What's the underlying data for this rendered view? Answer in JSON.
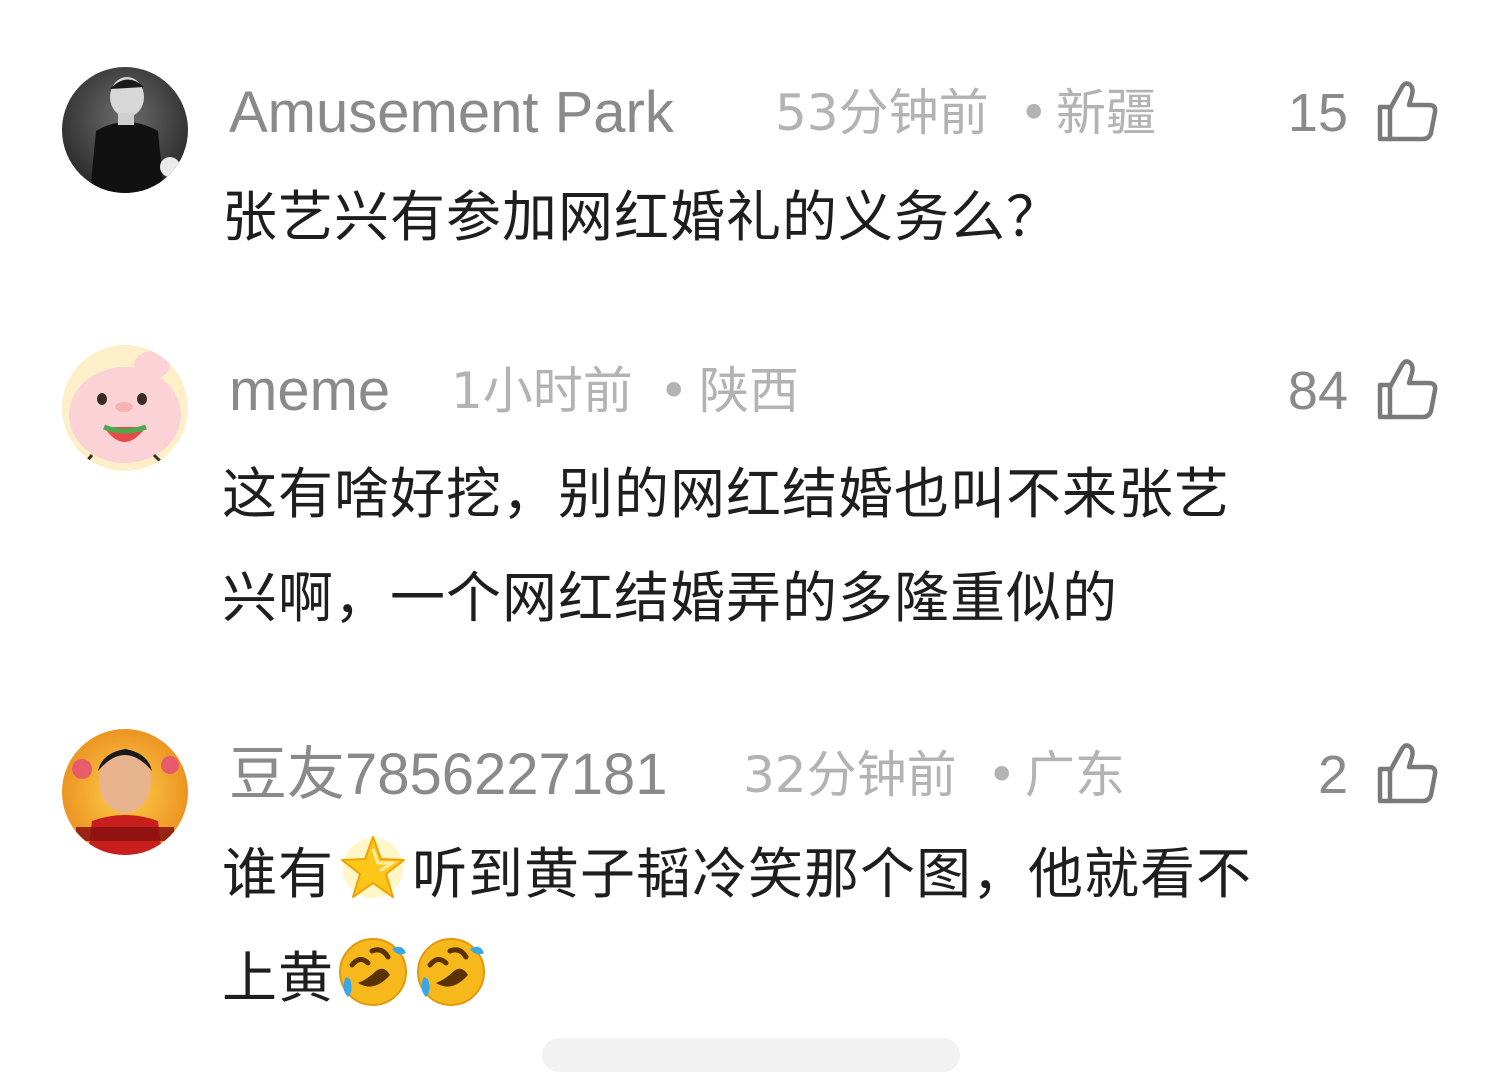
{
  "comments": [
    {
      "username": "Amusement Park",
      "time": "53分钟前",
      "location": "新疆",
      "separator": "•",
      "likes": "15",
      "text": "张艺兴有参加网红婚礼的义务么？"
    },
    {
      "username": "meme",
      "time": "1小时前",
      "location": "陕西",
      "separator": "•",
      "likes": "84",
      "text_line1": "这有啥好挖，别的网红结婚也叫不来张艺",
      "text_line2": "兴啊，一个网红结婚弄的多隆重似的"
    },
    {
      "username": "豆友7856227181",
      "time": "32分钟前",
      "location": "广东",
      "separator": "•",
      "likes": "2",
      "text_line1_a": "谁有",
      "text_line1_b": "听到黄子韬冷笑那个图，他就看不",
      "text_line2": "上黄"
    }
  ],
  "icons": {
    "like": "thumbs-up-icon",
    "star": "star-emoji",
    "laugh": "rofl-emoji"
  },
  "colors": {
    "username": "#8a8a8a",
    "meta": "#b3b3b3",
    "body_text": "#1e1e1e",
    "background": "#ffffff"
  }
}
